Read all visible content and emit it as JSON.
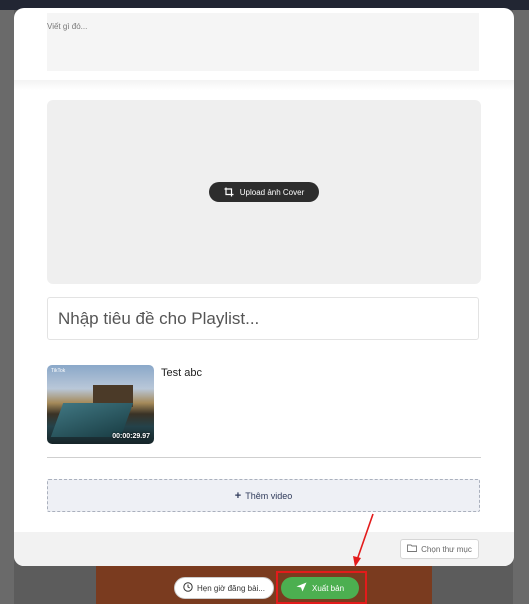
{
  "composer": {
    "description_placeholder": "Viết gì đó...",
    "upload_cover_label": "Upload ảnh Cover",
    "title_placeholder": "Nhập tiêu đề cho Playlist..."
  },
  "video": {
    "title": "Test abc",
    "duration": "00:00:29.97",
    "thumb_brand": "TikTok"
  },
  "actions": {
    "add_video_label": "Thêm video",
    "choose_folder_label": "Chọn thư mục",
    "schedule_label": "Hẹn giờ đăng bài...",
    "publish_label": "Xuất bản"
  },
  "colors": {
    "publish": "#4caf50",
    "highlight": "#e31b1b",
    "upload_button": "#2d2d2d"
  }
}
